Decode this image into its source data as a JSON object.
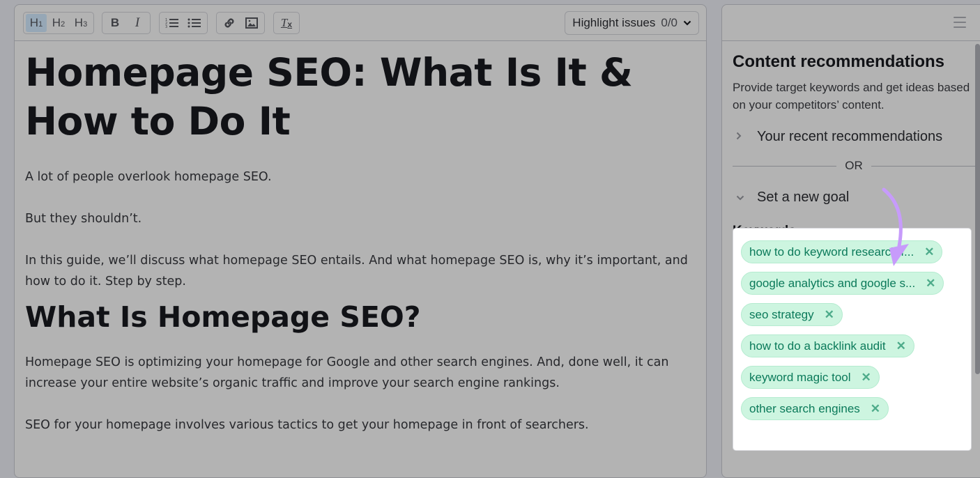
{
  "toolbar": {
    "heading_buttons": [
      {
        "label": "H",
        "level": "1",
        "active": true
      },
      {
        "label": "H",
        "level": "2",
        "active": false
      },
      {
        "label": "H",
        "level": "3",
        "active": false
      }
    ],
    "format_buttons": {
      "bold": "B",
      "italic": "I"
    },
    "clear_format": "T",
    "highlight_label": "Highlight issues",
    "highlight_count": "0/0"
  },
  "article": {
    "title": "Homepage SEO: What Is It & How to Do It",
    "paragraphs_intro": [
      "A lot of people overlook homepage SEO.",
      "But they shouldn’t.",
      "In this guide, we’ll discuss what homepage SEO entails. And what homepage SEO is, why it’s important, and how to do it. Step by step."
    ],
    "h2": "What Is Homepage SEO?",
    "paragraphs_section": [
      "Homepage SEO is optimizing your homepage for Google and other search engines. And, done well, it can increase your entire website’s organic traffic and improve your search engine rankings.",
      "SEO for your homepage involves various tactics to get your homepage in front of searchers."
    ]
  },
  "sidebar": {
    "title": "Content recommendations",
    "description": "Provide target keywords and get ideas based on your competitors’ content.",
    "recent_label": "Your recent recommendations",
    "or_label": "OR",
    "new_goal_label": "Set a new goal",
    "keywords_label": "Keywords",
    "keywords": [
      "how to do keyword research f...",
      "google analytics and google s...",
      "seo strategy",
      "how to do a backlink audit",
      "keyword magic tool",
      "other search engines"
    ],
    "annotation_color": "#c79bfb"
  }
}
